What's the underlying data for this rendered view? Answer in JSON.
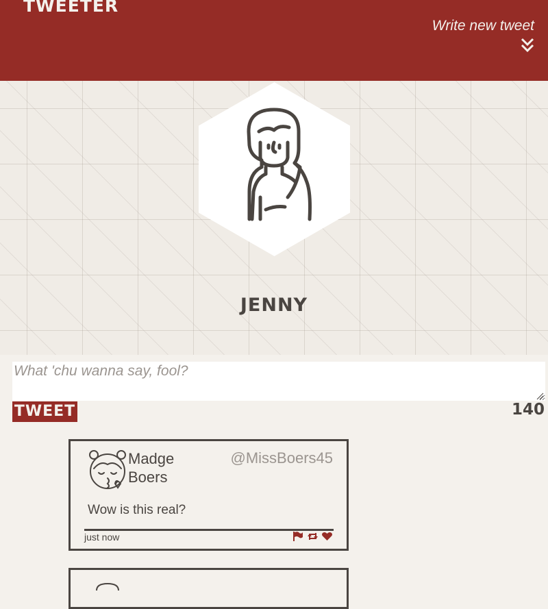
{
  "header": {
    "brand": "TWEETER",
    "write_new_tweet": "Write new tweet",
    "chevron_icon": "double-chevron-down-icon"
  },
  "profile": {
    "name": "JENNY",
    "avatar_icon": "woman-avatar-icon"
  },
  "compose": {
    "placeholder": "What 'chu wanna say, fool?",
    "value": "",
    "button_label": "TWEET",
    "char_counter": "140"
  },
  "tweets": [
    {
      "author_name": "Madge Boers",
      "handle": "@MissBoers45",
      "text": "Wow is this real?",
      "timestamp": "just now",
      "avatar_icon": "girl-kiss-avatar-icon",
      "actions": [
        "flag-icon",
        "retweet-icon",
        "heart-icon"
      ]
    }
  ],
  "colors": {
    "brand": "#952c26",
    "background": "#f4f1ec",
    "text": "#4a4541",
    "muted": "#9b9590"
  }
}
